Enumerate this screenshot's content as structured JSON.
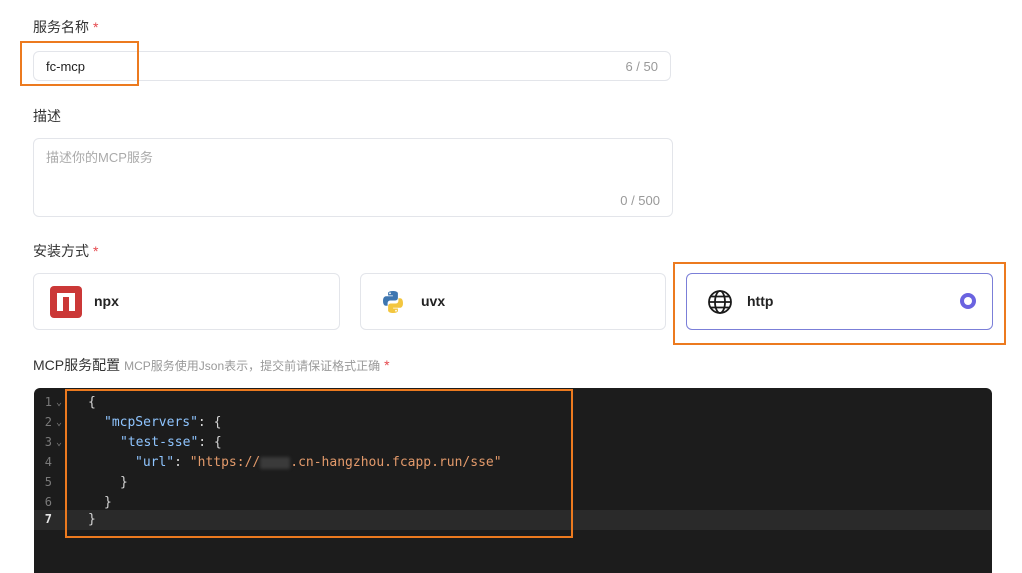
{
  "service_name": {
    "label": "服务名称",
    "required_mark": "*",
    "value": "fc-mcp",
    "counter": "6 / 50"
  },
  "description": {
    "label": "描述",
    "placeholder": "描述你的MCP服务",
    "counter": "0 / 500"
  },
  "install_method": {
    "label": "安装方式",
    "required_mark": "*",
    "options": [
      {
        "name": "npx",
        "icon": "npm-icon"
      },
      {
        "name": "uvx",
        "icon": "python-icon"
      },
      {
        "name": "http",
        "icon": "globe-icon",
        "selected": true
      }
    ]
  },
  "mcp_config": {
    "label": "MCP服务配置",
    "hint": "MCP服务使用Json表示，提交前请保证格式正确",
    "required_mark": "*",
    "line_numbers": [
      "1",
      "2",
      "3",
      "4",
      "5",
      "6",
      "7"
    ],
    "code": {
      "l1": "{",
      "l2_key": "\"mcpServers\"",
      "l2_rest": ": {",
      "l3_key": "\"test-sse\"",
      "l3_rest": ": {",
      "l4_key": "\"url\"",
      "l4_colon": ": ",
      "l4_str_start": "\"https://",
      "l4_str_end": ".cn-hangzhou.fcapp.run/sse\"",
      "l5": "}",
      "l6": "}",
      "l7": "}"
    },
    "active_line": 7
  },
  "colors": {
    "highlight": "#ec7a1f",
    "radio_selected": "#6a63e0",
    "editor_bg": "#1c1c1c"
  }
}
